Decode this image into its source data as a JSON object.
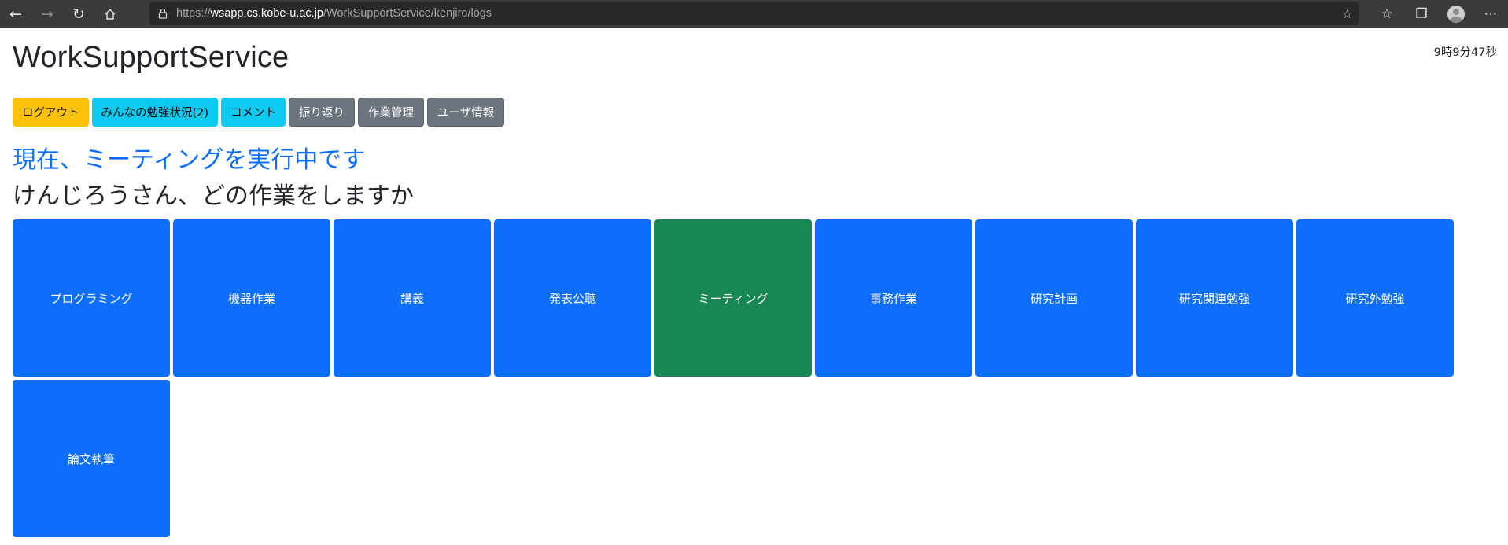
{
  "browser": {
    "url_scheme": "https://",
    "url_host": "wsapp.cs.kobe-u.ac.jp",
    "url_path": "/WorkSupportService/kenjiro/logs"
  },
  "header": {
    "title": "WorkSupportService",
    "clock": "9時9分47秒"
  },
  "menu": {
    "logout": "ログアウト",
    "everyone_status": "みんなの勉強状況(2)",
    "comment": "コメント",
    "review": "振り返り",
    "task_management": "作業管理",
    "user_info": "ユーザ情報"
  },
  "main": {
    "status": "現在、ミーティングを実行中です",
    "question": "けんじろうさん、どの作業をしますか"
  },
  "tasks": [
    {
      "label": "プログラミング",
      "active": false
    },
    {
      "label": "機器作業",
      "active": false
    },
    {
      "label": "講義",
      "active": false
    },
    {
      "label": "発表公聴",
      "active": false
    },
    {
      "label": "ミーティング",
      "active": true
    },
    {
      "label": "事務作業",
      "active": false
    },
    {
      "label": "研究計画",
      "active": false
    },
    {
      "label": "研究関連勉強",
      "active": false
    },
    {
      "label": "研究外勉強",
      "active": false
    },
    {
      "label": "論文執筆",
      "active": false
    }
  ],
  "colors": {
    "task_default": "#0d6efd",
    "task_active": "#198754",
    "status_text": "#0d6efd"
  }
}
